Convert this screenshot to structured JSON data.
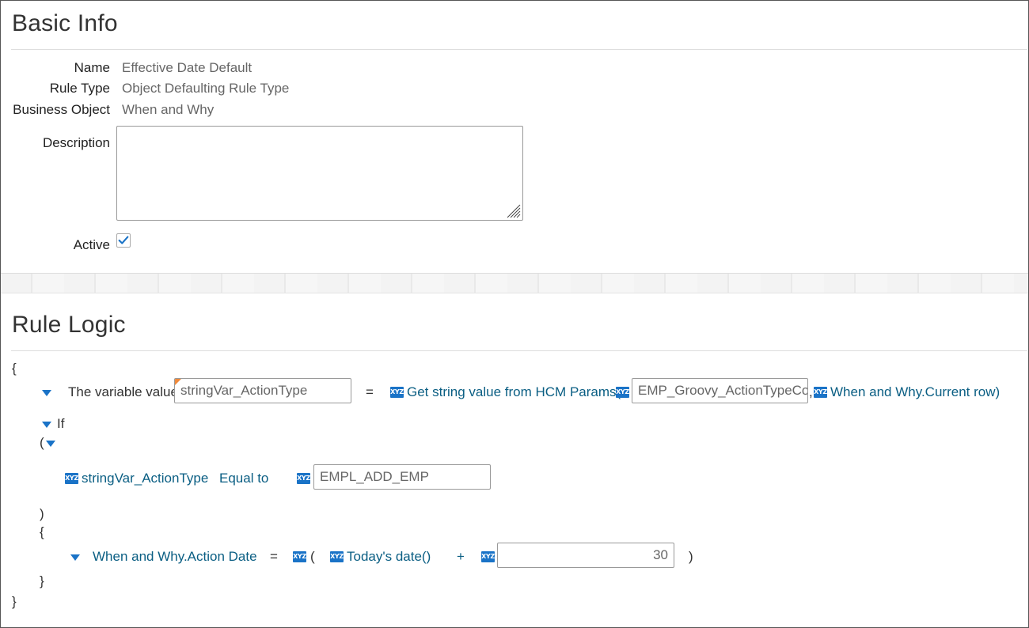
{
  "basic_info": {
    "title": "Basic Info",
    "name_label": "Name",
    "name_value": "Effective Date Default",
    "rule_type_label": "Rule Type",
    "rule_type_value": "Object Defaulting Rule Type",
    "business_object_label": "Business Object",
    "business_object_value": "When and Why",
    "description_label": "Description",
    "description_value": "",
    "active_label": "Active",
    "active_checked": true
  },
  "rule_logic": {
    "title": "Rule Logic",
    "open_brace": "{",
    "close_brace": "}",
    "assign": {
      "prefix": "The variable value",
      "variable": "stringVar_ActionType",
      "equals": "=",
      "function": "Get string value from HCM Params(",
      "param": "EMP_Groovy_ActionTypeCoc",
      "comma": ",",
      "arg": "When and Why.Current row)",
      "xyz_icon": "XYZ"
    },
    "if_block": {
      "keyword": "If",
      "open_paren": "(",
      "close_paren": ")",
      "open_brace": "{",
      "close_brace": "}",
      "condition": {
        "left": "stringVar_ActionType",
        "operator": "Equal to",
        "right": "EMPL_ADD_EMP"
      },
      "action": {
        "target": "When and Why.Action Date",
        "equals": "=",
        "open_paren": "(",
        "function": "Today's date()",
        "plus": "+",
        "amount": "30",
        "close_paren": ")"
      }
    }
  },
  "colors": {
    "link": "#0a5e83",
    "accent": "#1a73c7",
    "flag": "#f08a3c"
  }
}
